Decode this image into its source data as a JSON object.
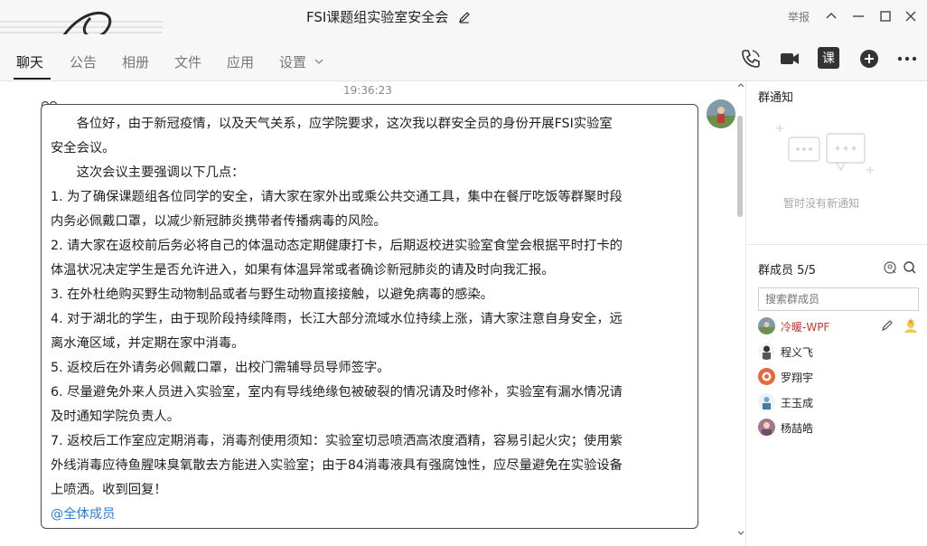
{
  "window": {
    "title": "FSI课题组实验室安全会",
    "report_label": "举报"
  },
  "tabs": [
    {
      "label": "聊天"
    },
    {
      "label": "公告"
    },
    {
      "label": "相册"
    },
    {
      "label": "文件"
    },
    {
      "label": "应用"
    },
    {
      "label": "设置"
    }
  ],
  "toolbar": {
    "voice_icon": "phone-icon",
    "video_icon": "video-icon",
    "class_label": "课",
    "add_icon": "plus-icon",
    "more_icon": "more-icon"
  },
  "chat": {
    "timestamp": "19:36:23",
    "message_lines": [
      "　　各位好，由于新冠疫情，以及天气关系，应学院要求，这次我以群安全员的身份开展FSI实验室",
      "安全会议。",
      "　　这次会议主要强调以下几点：",
      "1. 为了确保课题组各位同学的安全，请大家在家外出或乘公共交通工具，集中在餐厅吃饭等群聚时段",
      "内务必佩戴口罩，以减少新冠肺炎携带者传播病毒的风险。",
      "2. 请大家在返校前后务必将自己的体温动态定期健康打卡，后期返校进实验室食堂会根据平时打卡的",
      "体温状况决定学生是否允许进入，如果有体温异常或者确诊新冠肺炎的请及时向我汇报。",
      "3. 在外杜绝购买野生动物制品或者与野生动物直接接触，以避免病毒的感染。",
      "4. 对于湖北的学生，由于现阶段持续降雨，长江大部分流域水位持续上涨，请大家注意自身安全，远",
      "离水淹区域，并定期在家中消毒。",
      "5. 返校后在外请务必佩戴口罩，出校门需辅导员导师签字。",
      "6. 尽量避免外来人员进入实验室，室内有导线绝缘包被破裂的情况请及时修补，实验室有漏水情况请",
      "及时通知学院负责人。",
      "7. 返校后工作室应定期消毒，消毒剂使用须知：实验室切忌喷洒高浓度酒精，容易引起火灾；使用紫",
      "外线消毒应待鱼腥味臭氧散去方能进入实验室；由于84消毒液具有强腐蚀性，应尽量避免在实验设备",
      "上喷洒。收到回复！"
    ],
    "mention": "@全体成员"
  },
  "sidebar": {
    "notice_title": "群通知",
    "notice_empty": "暂时没有新通知",
    "members_title": "群成员 5/5",
    "search_placeholder": "搜索群成员",
    "members": [
      {
        "name": "冷暖-WPF",
        "color": "#d43030"
      },
      {
        "name": "程义飞",
        "color": "#222222"
      },
      {
        "name": "罗翔宇",
        "color": "#222222"
      },
      {
        "name": "王玉成",
        "color": "#222222"
      },
      {
        "name": "杨喆皓",
        "color": "#222222"
      }
    ]
  },
  "colors": {
    "accent": "#1a1a1a",
    "mention": "#2d7bd6",
    "owner": "#d43030"
  }
}
